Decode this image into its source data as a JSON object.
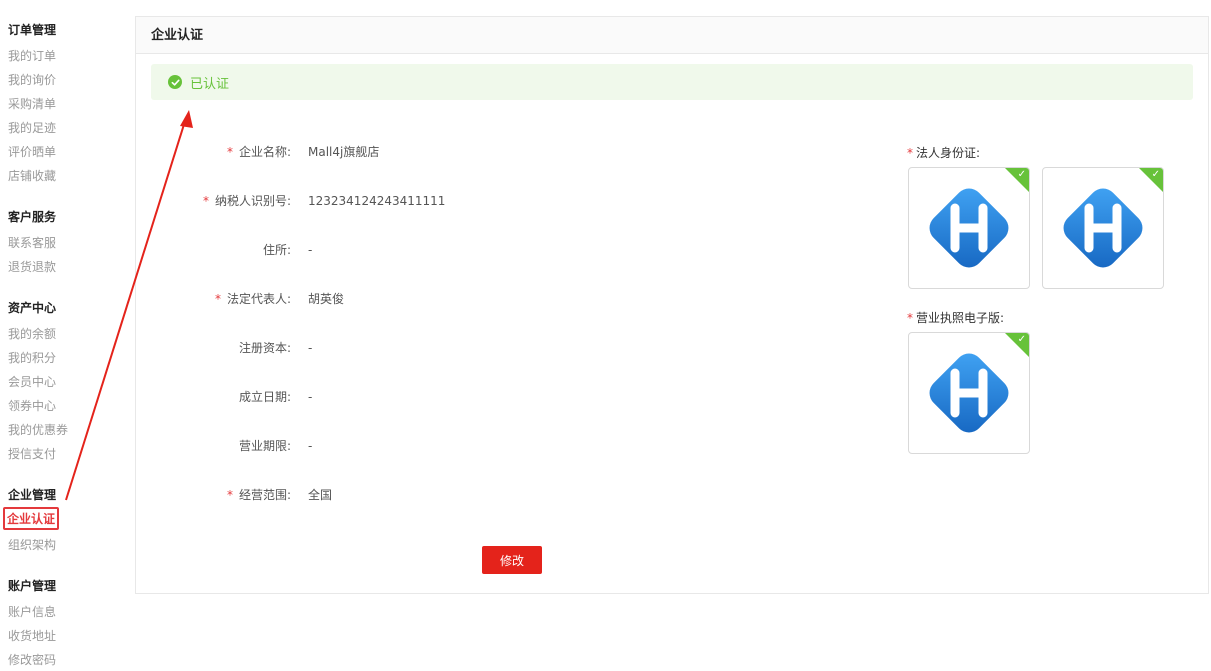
{
  "sidebar": {
    "groups": [
      {
        "title": "订单管理",
        "items": [
          "我的订单",
          "我的询价",
          "采购清单",
          "我的足迹",
          "评价晒单",
          "店铺收藏"
        ]
      },
      {
        "title": "客户服务",
        "items": [
          "联系客服",
          "退货退款"
        ]
      },
      {
        "title": "资产中心",
        "items": [
          "我的余额",
          "我的积分",
          "会员中心",
          "领券中心",
          "我的优惠券",
          "授信支付"
        ]
      },
      {
        "title": "企业管理",
        "items": [
          "企业认证",
          "组织架构"
        ]
      },
      {
        "title": "账户管理",
        "items": [
          "账户信息",
          "收货地址",
          "修改密码"
        ]
      }
    ]
  },
  "panel": {
    "title": "企业认证",
    "status": "已认证",
    "fields": [
      {
        "label": "企业名称:",
        "value": "Mall4j旗舰店",
        "required": true
      },
      {
        "label": "纳税人识别号:",
        "value": "123234124243411111",
        "required": true
      },
      {
        "label": "住所:",
        "value": "-",
        "required": false
      },
      {
        "label": "法定代表人:",
        "value": "胡英俊",
        "required": true
      },
      {
        "label": "注册资本:",
        "value": "-",
        "required": false
      },
      {
        "label": "成立日期:",
        "value": "-",
        "required": false
      },
      {
        "label": "营业期限:",
        "value": "-",
        "required": false
      },
      {
        "label": "经营范围:",
        "value": "全国",
        "required": true
      }
    ],
    "edit_label": "修改",
    "id_card_label": "法人身份证:",
    "license_label": "营业执照电子版:",
    "required_mark": "*",
    "check_mark": "✓"
  },
  "colors": {
    "accent": "#e4231b",
    "success": "#67c23a",
    "success_bg": "#f0f9eb",
    "logo_blue": "#1e88e5"
  }
}
